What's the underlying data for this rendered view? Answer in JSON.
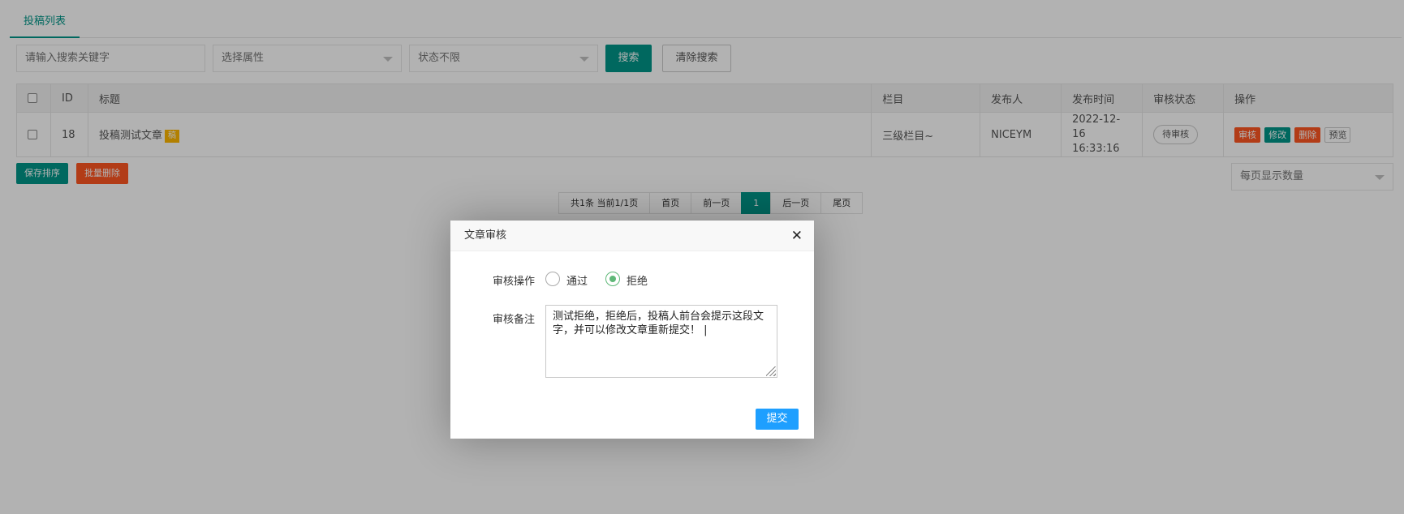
{
  "tabs": [
    {
      "label": "投稿列表"
    }
  ],
  "search": {
    "keyword_placeholder": "请输入搜索关键字",
    "attribute_select": "选择属性",
    "status_select": "状态不限",
    "search_label": "搜索",
    "clear_label": "清除搜索"
  },
  "table": {
    "headers": [
      "ID",
      "标题",
      "栏目",
      "发布人",
      "发布时间",
      "审核状态",
      "操作"
    ],
    "rows": [
      {
        "id": "18",
        "title": "投稿测试文章",
        "title_badge": "稿",
        "column": "三级栏目~",
        "publisher": "NICEYM",
        "date": "2022-12-16",
        "time": "16:33:16",
        "status": "待审核",
        "actions": [
          "审核",
          "修改",
          "删除",
          "预览"
        ]
      }
    ]
  },
  "bottom": {
    "save_sort": "保存排序",
    "batch_delete": "批量删除",
    "page_size_select": "每页显示数量"
  },
  "pager": {
    "summary": "共1条 当前1/1页",
    "first": "首页",
    "prev": "前一页",
    "current": "1",
    "next": "后一页",
    "last": "尾页"
  },
  "dialog": {
    "title": "文章审核",
    "close_icon": "close-icon",
    "op_label": "审核操作",
    "options": [
      {
        "label": "通过",
        "checked": false
      },
      {
        "label": "拒绝",
        "checked": true
      }
    ],
    "remark_label": "审核备注",
    "remark_value": "测试拒绝，拒绝后，投稿人前台会提示这段文字，并可以修改文章重新提交！",
    "submit_label": "提交"
  },
  "colors": {
    "primary": "#009688",
    "danger": "#ff5722",
    "warning": "#ffb800",
    "submit": "#1e9fff",
    "radio_on": "#5fb878"
  }
}
